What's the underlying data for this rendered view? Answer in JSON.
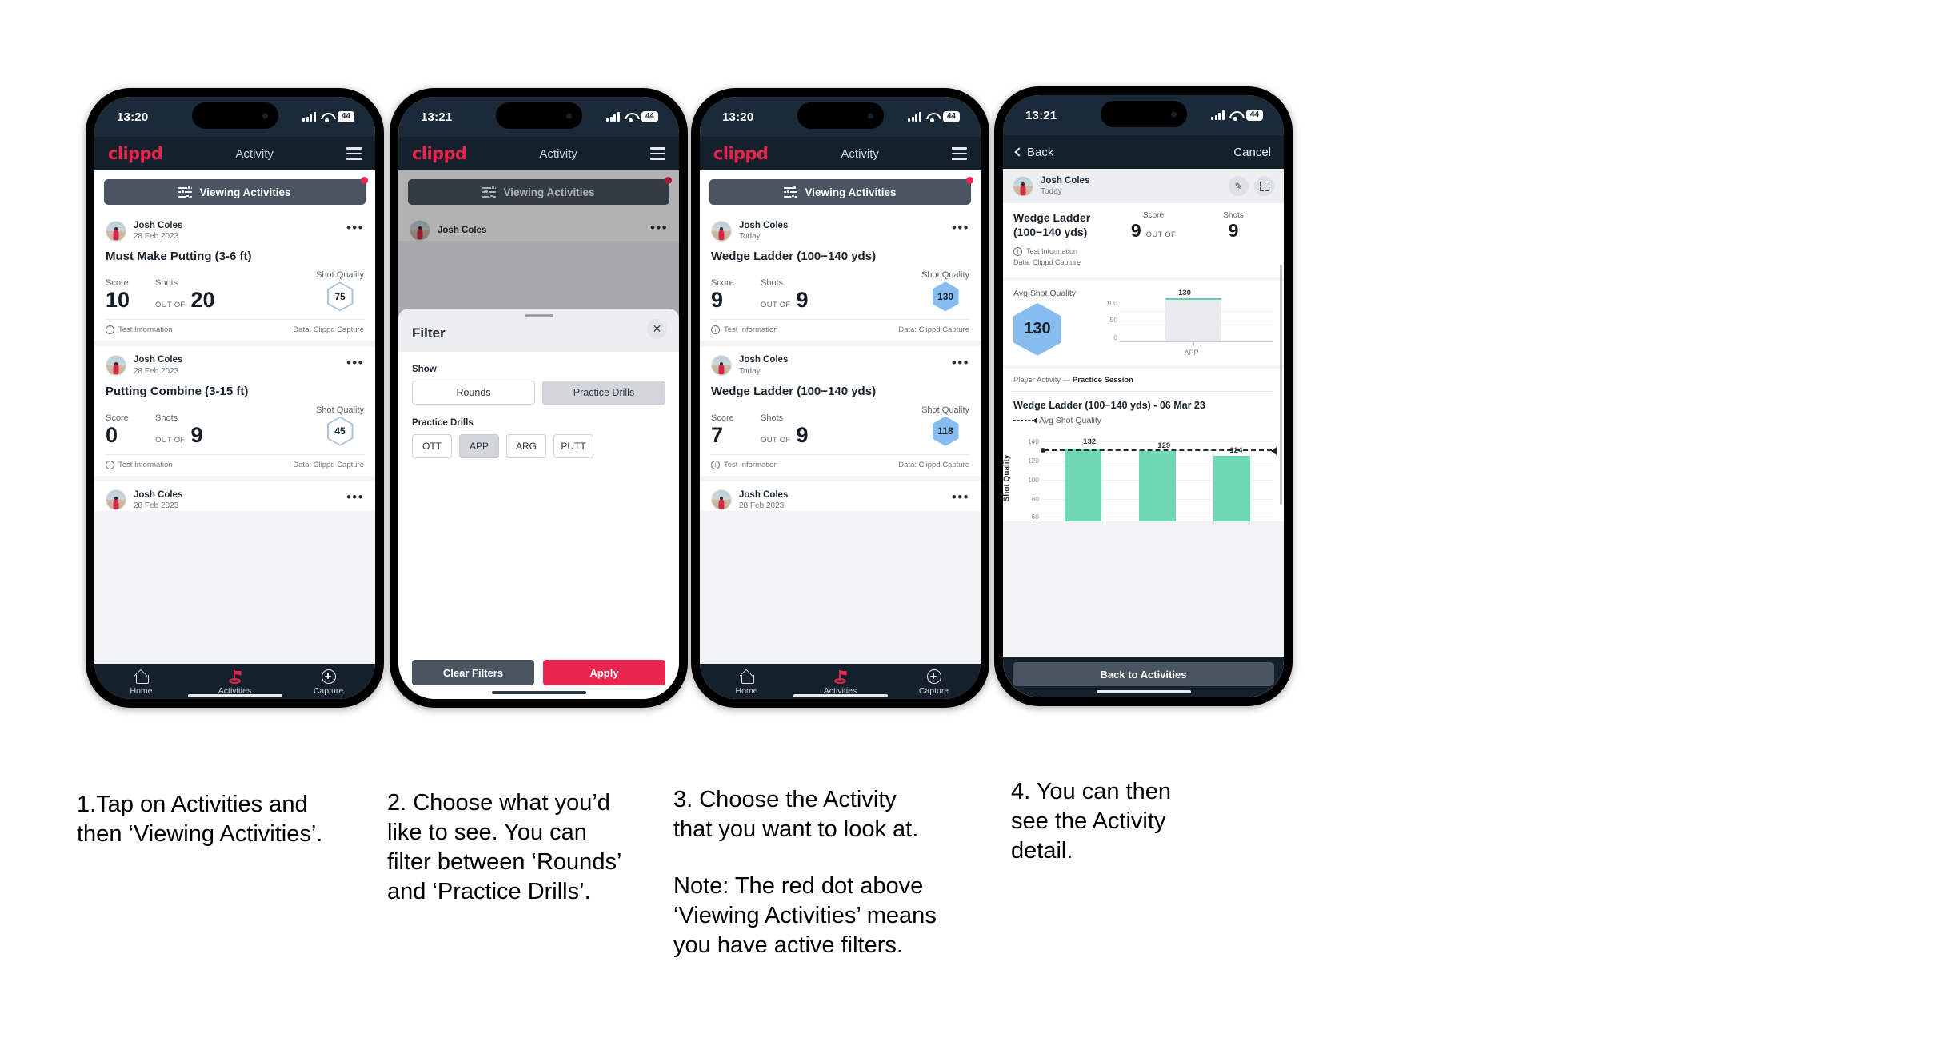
{
  "phones": [
    {
      "status": {
        "time": "13:20",
        "battery": "44"
      },
      "appbar": {
        "logo": "clippd",
        "title": "Activity",
        "menu": "hamburger-icon"
      },
      "viewing_bar": {
        "label": "Viewing Activities",
        "has_red_dot": true
      },
      "cards": [
        {
          "name": "Josh Coles",
          "date": "28 Feb 2023",
          "title": "Must Make Putting (3-6 ft)",
          "score_label": "Score",
          "shots_label": "Shots",
          "score": "10",
          "out_of": "OUT OF",
          "shots": "20",
          "sq_label": "Shot Quality",
          "sq_value": "75",
          "sq_style": "outline",
          "foot_left": "Test Information",
          "foot_right": "Data: Clippd Capture"
        },
        {
          "name": "Josh Coles",
          "date": "28 Feb 2023",
          "title": "Putting Combine (3-15 ft)",
          "score_label": "Score",
          "shots_label": "Shots",
          "score": "0",
          "out_of": "OUT OF",
          "shots": "9",
          "sq_label": "Shot Quality",
          "sq_value": "45",
          "sq_style": "outline",
          "foot_left": "Test Information",
          "foot_right": "Data: Clippd Capture"
        },
        {
          "name": "Josh Coles",
          "date": "28 Feb 2023"
        }
      ],
      "tabs": [
        {
          "label": "Home",
          "icon": "home-icon",
          "active": false
        },
        {
          "label": "Activities",
          "icon": "golf-flag-icon",
          "active": true
        },
        {
          "label": "Capture",
          "icon": "plus-circle-icon",
          "active": false
        }
      ]
    },
    {
      "status": {
        "time": "13:21",
        "battery": "44"
      },
      "appbar": {
        "logo": "clippd",
        "title": "Activity",
        "menu": "hamburger-icon"
      },
      "viewing_bar": {
        "label": "Viewing Activities",
        "has_red_dot": true
      },
      "behind_card": {
        "name": "Josh Coles"
      },
      "sheet": {
        "title": "Filter",
        "close": "close-icon",
        "show_label": "Show",
        "show_options": [
          {
            "label": "Rounds",
            "selected": false
          },
          {
            "label": "Practice Drills",
            "selected": true
          }
        ],
        "drills_label": "Practice Drills",
        "drill_options": [
          {
            "label": "OTT",
            "selected": false
          },
          {
            "label": "APP",
            "selected": true
          },
          {
            "label": "ARG",
            "selected": false
          },
          {
            "label": "PUTT",
            "selected": false
          }
        ],
        "clear_label": "Clear Filters",
        "apply_label": "Apply"
      }
    },
    {
      "status": {
        "time": "13:20",
        "battery": "44"
      },
      "appbar": {
        "logo": "clippd",
        "title": "Activity",
        "menu": "hamburger-icon"
      },
      "viewing_bar": {
        "label": "Viewing Activities",
        "has_red_dot": true
      },
      "cards": [
        {
          "name": "Josh Coles",
          "date": "Today",
          "title": "Wedge Ladder (100−140 yds)",
          "score_label": "Score",
          "shots_label": "Shots",
          "score": "9",
          "out_of": "OUT OF",
          "shots": "9",
          "sq_label": "Shot Quality",
          "sq_value": "130",
          "sq_style": "filled",
          "foot_left": "Test Information",
          "foot_right": "Data: Clippd Capture"
        },
        {
          "name": "Josh Coles",
          "date": "Today",
          "title": "Wedge Ladder (100−140 yds)",
          "score_label": "Score",
          "shots_label": "Shots",
          "score": "7",
          "out_of": "OUT OF",
          "shots": "9",
          "sq_label": "Shot Quality",
          "sq_value": "118",
          "sq_style": "filled",
          "foot_left": "Test Information",
          "foot_right": "Data: Clippd Capture"
        },
        {
          "name": "Josh Coles",
          "date": "28 Feb 2023"
        }
      ],
      "tabs": [
        {
          "label": "Home",
          "icon": "home-icon",
          "active": false
        },
        {
          "label": "Activities",
          "icon": "golf-flag-icon",
          "active": true
        },
        {
          "label": "Capture",
          "icon": "plus-circle-icon",
          "active": false
        }
      ]
    },
    {
      "status": {
        "time": "13:21",
        "battery": "44"
      },
      "navbar": {
        "back": "Back",
        "cancel": "Cancel"
      },
      "detail": {
        "name": "Josh Coles",
        "date": "Today",
        "edit_icon": "pencil-icon",
        "expand_icon": "expand-icon",
        "title": "Wedge Ladder (100−140 yds)",
        "info_line": "Test Information",
        "data_line": "Data: Clippd Capture",
        "score_label": "Score",
        "shots_label": "Shots",
        "score": "9",
        "out_of": "OUT OF",
        "shots": "9",
        "avg_label": "Avg Shot Quality",
        "avg_value": "130",
        "breadcrumb_prefix": "Player Activity —",
        "breadcrumb_current": "Practice Session",
        "chart_title": "Wedge Ladder (100−140 yds) - 06 Mar 23",
        "legend": "Avg Shot Quality",
        "back_button": "Back to Activities"
      }
    }
  ],
  "chart_data": [
    {
      "type": "bar",
      "title": "",
      "categories": [
        "APP"
      ],
      "values": [
        130
      ],
      "data_labels": [
        "130"
      ],
      "ylabel": "",
      "ytick_labels": [
        "100",
        "50",
        "0"
      ],
      "ylim": [
        0,
        140
      ],
      "xlabel": "APP",
      "grid": true,
      "legend": ""
    },
    {
      "type": "bar",
      "title": "Wedge Ladder (100−140 yds) - 06 Mar 23",
      "categories": [
        "",
        "",
        ""
      ],
      "values": [
        132,
        129,
        124
      ],
      "data_labels": [
        "132",
        "129",
        "124"
      ],
      "ylabel": "Shot Quality",
      "ytick_labels": [
        "140",
        "120",
        "100",
        "80",
        "60"
      ],
      "ylim": [
        50,
        145
      ],
      "grid": true,
      "legend": "Avg Shot Quality",
      "annotation": {
        "type": "dashed-trend-line",
        "label": "Avg Shot Quality"
      },
      "bar_color": "#6fd8b4"
    }
  ],
  "captions": [
    {
      "lines": [
        "1.Tap on Activities and",
        "then ‘Viewing Activities’."
      ]
    },
    {
      "lines": [
        "2. Choose what you’d",
        "like to see. You can",
        "filter between ‘Rounds’",
        "and ‘Practice Drills’."
      ]
    },
    {
      "lines": [
        "3. Choose the Activity",
        "that you want to look at."
      ],
      "note": [
        "Note: The red dot above",
        "‘Viewing Activities’ means",
        "you have active filters."
      ]
    },
    {
      "lines": [
        "4. You can then",
        "see the Activity",
        "detail."
      ]
    }
  ],
  "colors": {
    "brand": "#e8254f",
    "dark": "#14202b",
    "slate": "#4a5561",
    "teal": "#6fd8b4",
    "blue": "#86bdee"
  }
}
